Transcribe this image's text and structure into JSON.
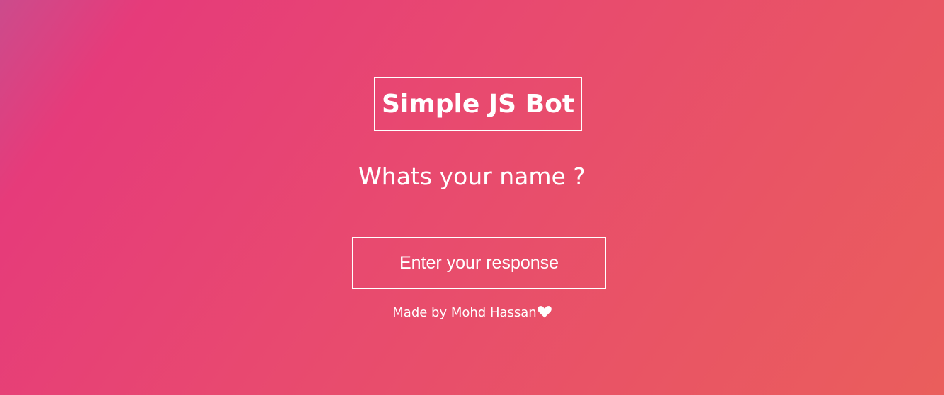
{
  "header": {
    "title": "Simple JS Bot"
  },
  "main": {
    "question": "Whats your name ?",
    "input": {
      "placeholder": "Enter your response",
      "value": ""
    }
  },
  "footer": {
    "credit": "Made by Mohd Hassan",
    "icon": "heart-icon"
  },
  "colors": {
    "background_start": "#cc4b8c",
    "background_end": "#ea5e5c",
    "foreground": "#ffffff"
  }
}
